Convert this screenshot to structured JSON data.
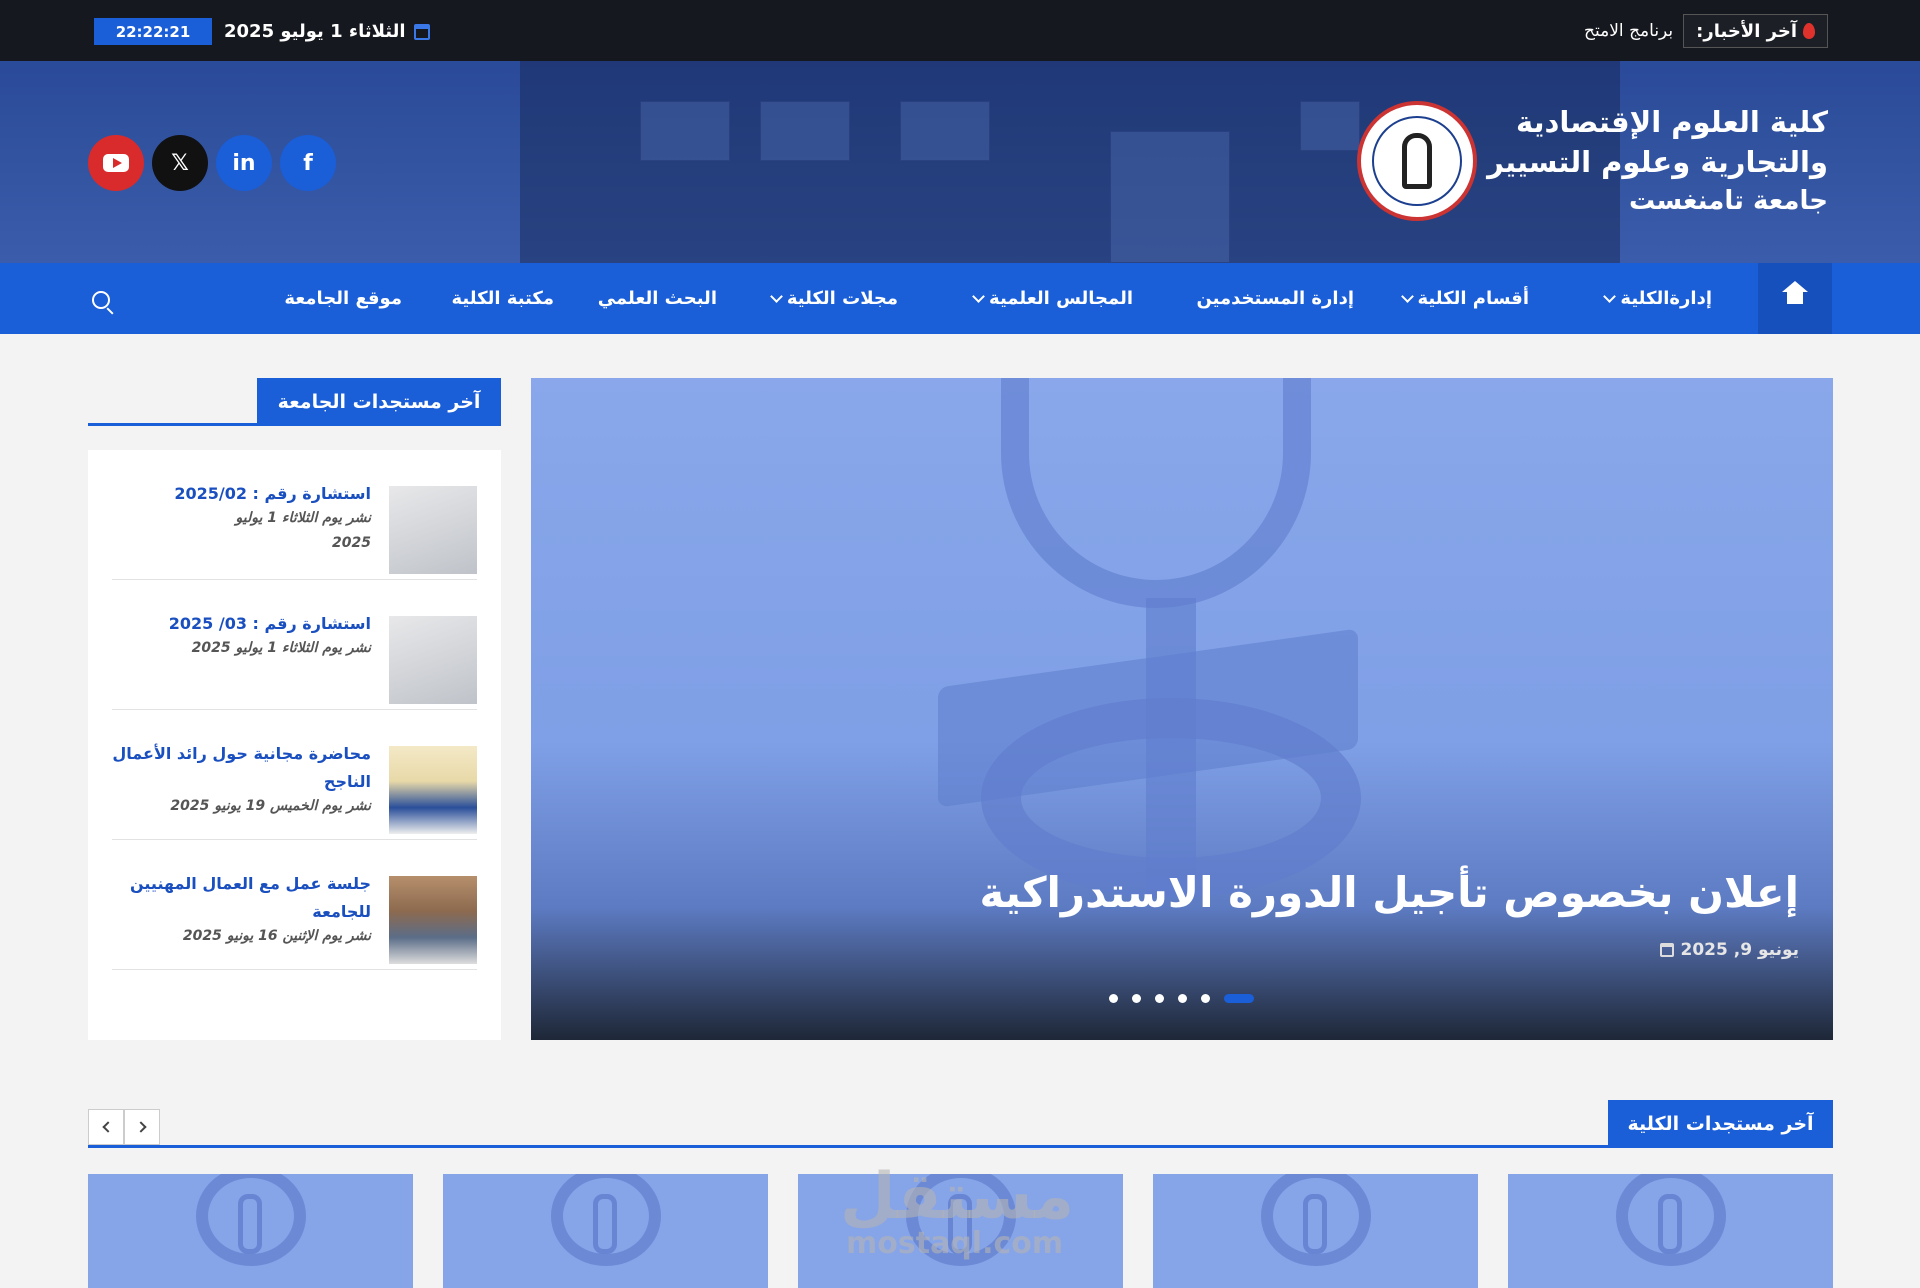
{
  "topbar": {
    "news_label": "آخر الأخبار:",
    "news_ticker": "برنامج الامتح",
    "date": "الثلاثاء 1 يوليو 2025",
    "clock": "22:22:21"
  },
  "header": {
    "faculty_line1": "كلية العلوم الإقتصادية",
    "faculty_line2": "والتجارية وعلوم التسيير",
    "university": "جامعة تامنغست",
    "social": [
      "youtube-icon",
      "x-icon",
      "linkedin-icon",
      "facebook-icon"
    ]
  },
  "nav": {
    "items": [
      {
        "label": "إدارةالكلية",
        "dropdown": true
      },
      {
        "label": "أقسام الكلية",
        "dropdown": true
      },
      {
        "label": "إدارة المستخدمين",
        "dropdown": false
      },
      {
        "label": "المجالس العلمية",
        "dropdown": true
      },
      {
        "label": "مجلات الكلية",
        "dropdown": true
      },
      {
        "label": "البحث العلمي",
        "dropdown": false
      },
      {
        "label": "مكتبة الكلية",
        "dropdown": false
      },
      {
        "label": "موقع الجامعة",
        "dropdown": false
      }
    ]
  },
  "slider": {
    "title": "إعلان بخصوص تأجيل الدورة الاستدراكية",
    "date": "يونيو 9, 2025",
    "slide_count": 6,
    "active_index": 0
  },
  "sidebar": {
    "heading": "آخر مستجدات الجامعة",
    "items": [
      {
        "title": "استشارة رقم : 2025/02",
        "meta_line1": "نشر يوم الثلاثاء 1 يوليو",
        "meta_line2": "2025"
      },
      {
        "title": "استشارة رقم : 03/ 2025",
        "meta_line1": "نشر يوم الثلاثاء 1 يوليو 2025",
        "meta_line2": ""
      },
      {
        "title": "محاضرة مجانية حول رائد الأعمال الناجح",
        "meta_line1": "نشر يوم الخميس 19 يونيو 2025",
        "meta_line2": ""
      },
      {
        "title": "جلسة عمل مع العمال المهنيين للجامعة",
        "meta_line1": "نشر يوم الإثنين 16 يونيو 2025",
        "meta_line2": ""
      }
    ]
  },
  "section": {
    "heading": "آخر مستجدات الكلية"
  },
  "watermark": {
    "arabic": "مستقل",
    "latin": "mostaql.com"
  },
  "colors": {
    "primary": "#1a5ed8",
    "topbar": "#15181e",
    "youtube": "#d92b2b"
  }
}
